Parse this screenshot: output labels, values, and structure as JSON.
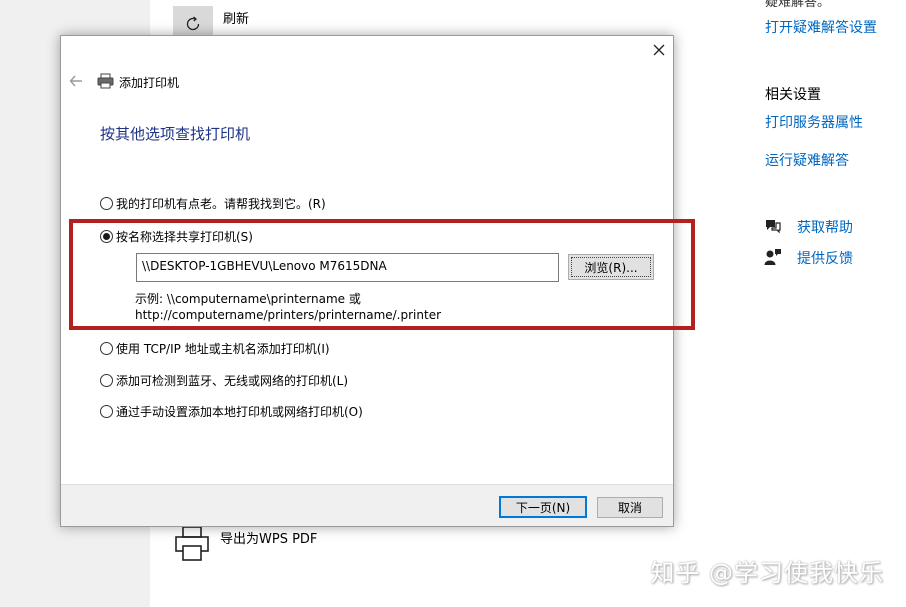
{
  "background": {
    "refresh_label": "刷新",
    "wps_label": "导出为WPS PDF",
    "sidebar": {
      "cut_text": "疑难解答。",
      "troubleshoot_settings_link": "打开疑难解答设置",
      "related_heading": "相关设置",
      "print_server_link": "打印服务器属性",
      "run_troubleshooter_link": "运行疑难解答",
      "get_help_link": "获取帮助",
      "feedback_link": "提供反馈"
    },
    "watermark": "知乎 @学习使我快乐",
    "link_color": "#0067c0"
  },
  "dialog": {
    "title": "添加打印机",
    "heading": "按其他选项查找打印机",
    "heading_color": "#1e3287",
    "options": [
      {
        "label": "我的打印机有点老。请帮我找到它。(R)",
        "checked": false
      },
      {
        "label": "按名称选择共享打印机(S)",
        "checked": true
      },
      {
        "label": "使用 TCP/IP 地址或主机名添加打印机(I)",
        "checked": false
      },
      {
        "label": "添加可检测到蓝牙、无线或网络的打印机(L)",
        "checked": false
      },
      {
        "label": "通过手动设置添加本地打印机或网络打印机(O)",
        "checked": false
      }
    ],
    "share_input_value": "\\\\DESKTOP-1GBHEVU\\Lenovo M7615DNA",
    "browse_label": "浏览(R)...",
    "example_line1": "示例: \\\\computername\\printername 或",
    "example_line2": "http://computername/printers/printername/.printer",
    "next_label": "下一页(N)",
    "cancel_label": "取消",
    "highlight_color": "#b3201f",
    "accent_color": "#0078d7"
  }
}
